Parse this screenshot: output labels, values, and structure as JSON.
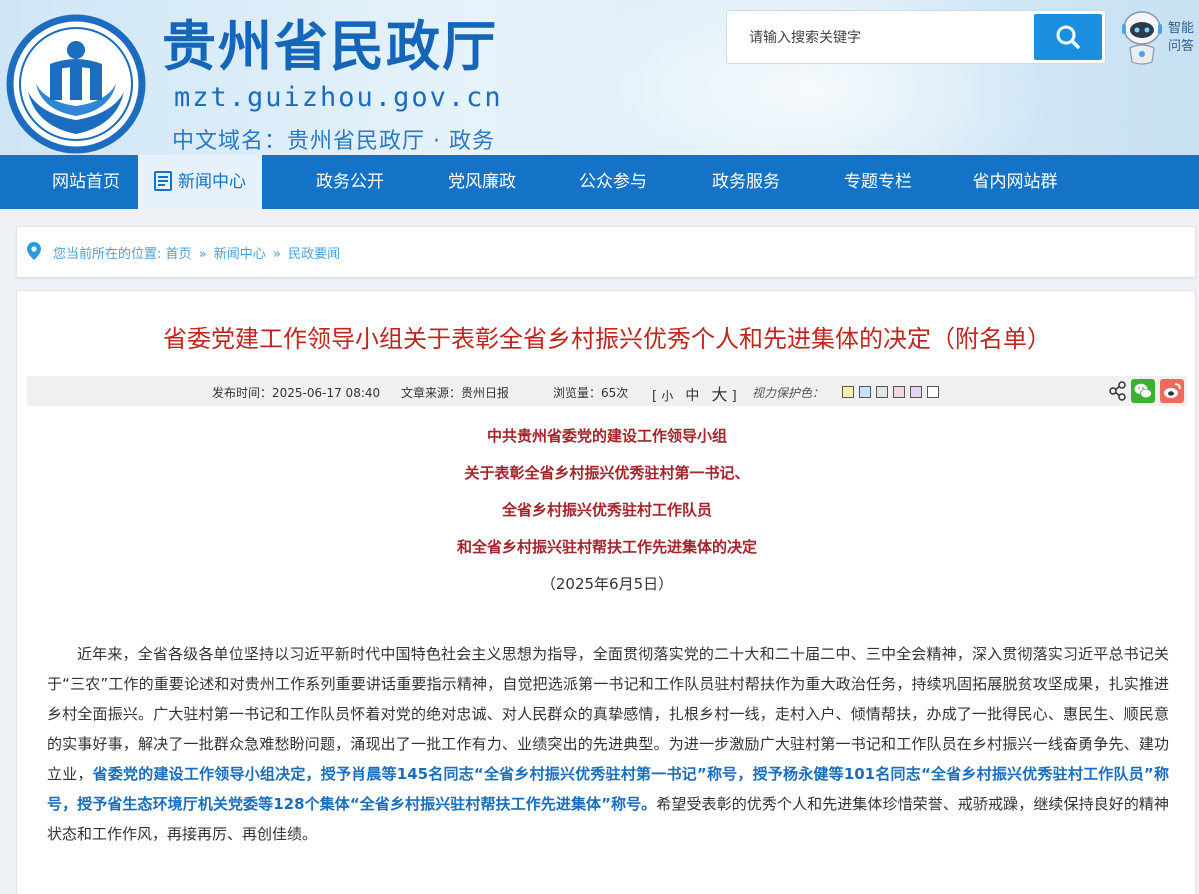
{
  "header": {
    "site_title": "贵州省民政厅",
    "site_domain": "mzt.guizhou.gov.cn",
    "site_cn_domain": "中文域名：贵州省民政厅 · 政务",
    "search_placeholder": "请输入搜索关键字",
    "robot_label_line1": "智能",
    "robot_label_line2": "问答"
  },
  "nav": {
    "items": [
      {
        "label": "网站首页"
      },
      {
        "label": "新闻中心"
      },
      {
        "label": "政务公开"
      },
      {
        "label": "党风廉政"
      },
      {
        "label": "公众参与"
      },
      {
        "label": "政务服务"
      },
      {
        "label": "专题专栏"
      },
      {
        "label": "省内网站群"
      }
    ],
    "active_index": 1
  },
  "breadcrumb": {
    "prefix": "您当前所在的位置:",
    "items": [
      "首页",
      "新闻中心",
      "民政要闻"
    ],
    "separator": "»"
  },
  "article": {
    "title": "省委党建工作领导小组关于表彰全省乡村振兴优秀个人和先进集体的决定（附名单）",
    "meta": {
      "publish_time": "发布时间：2025-06-17 08:40",
      "source": "文章来源：贵州日报",
      "views": "浏览量：65次",
      "font_open": "[",
      "font_small": "小",
      "font_medium": "中",
      "font_large": "大",
      "font_close": "]",
      "vision_label": "视力保护色：",
      "swatches": [
        "#fbeeb0",
        "#c5e3f5",
        "#e4e4e4",
        "#f3d5dc",
        "#e3d2f0",
        "#ffffff"
      ]
    },
    "doc_head": [
      "中共贵州省委党的建设工作领导小组",
      "关于表彰全省乡村振兴优秀驻村第一书记、",
      "全省乡村振兴优秀驻村工作队员",
      "和全省乡村振兴驻村帮扶工作先进集体的决定"
    ],
    "doc_date": "（2025年6月5日）",
    "body_part1": "近年来，全省各级各单位坚持以习近平新时代中国特色社会主义思想为指导，全面贯彻落实党的二十大和二十届二中、三中全会精神，深入贯彻落实习近平总书记关于“三农”工作的重要论述和对贵州工作系列重要讲话重要指示精神，自觉把选派第一书记和工作队员驻村帮扶作为重大政治任务，持续巩固拓展脱贫攻坚成果，扎实推进乡村全面振兴。广大驻村第一书记和工作队员怀着对党的绝对忠诚、对人民群众的真挚感情，扎根乡村一线，走村入户、倾情帮扶，办成了一批得民心、惠民生、顺民意的实事好事，解决了一批群众急难愁盼问题，涌现出了一批工作有力、业绩突出的先进典型。为进一步激励广大驻村第一书记和工作队员在乡村振兴一线奋勇争先、建功立业，",
    "body_highlight": "省委党的建设工作领导小组决定，授予肖晨等145名同志“全省乡村振兴优秀驻村第一书记”称号，授予杨永健等101名同志“全省乡村振兴优秀驻村工作队员”称号，授予省生态环境厅机关党委等128个集体“全省乡村振兴驻村帮扶工作先进集体”称号。",
    "body_part2": "希望受表彰的优秀个人和先进集体珍惜荣誉、戒骄戒躁，继续保持良好的精神状态和工作作风，再接再厉、再创佳绩。"
  }
}
